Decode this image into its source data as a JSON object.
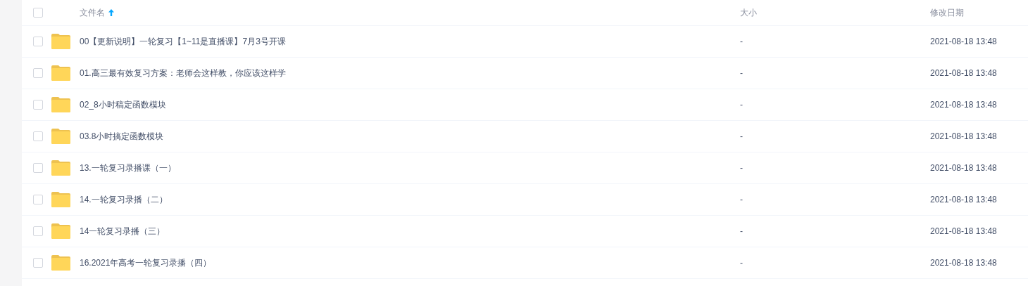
{
  "header": {
    "select_all": {
      "checked": false
    },
    "columns": [
      {
        "label": "文件名",
        "sorted": true
      },
      {
        "label": "大小",
        "sorted": false
      },
      {
        "label": "修改日期",
        "sorted": false
      }
    ]
  },
  "rows": [
    {
      "checked": false,
      "name": "00【更新说明】一轮复习【1~11是直播课】7月3号开课",
      "size": "-",
      "modified": "2021-08-18 13:48"
    },
    {
      "checked": false,
      "name": "01.高三最有效复习方案：老师会这样教，你应该这样学",
      "size": "-",
      "modified": "2021-08-18 13:48"
    },
    {
      "checked": false,
      "name": "02_8小时稿定函数模块",
      "size": "-",
      "modified": "2021-08-18 13:48"
    },
    {
      "checked": false,
      "name": "03.8小时搞定函数模块",
      "size": "-",
      "modified": "2021-08-18 13:48"
    },
    {
      "checked": false,
      "name": "13.一轮复习录播课（一）",
      "size": "-",
      "modified": "2021-08-18 13:48"
    },
    {
      "checked": false,
      "name": "14.一轮复习录播（二）",
      "size": "-",
      "modified": "2021-08-18 13:48"
    },
    {
      "checked": false,
      "name": "14一轮复习录播（三）",
      "size": "-",
      "modified": "2021-08-18 13:48"
    },
    {
      "checked": false,
      "name": "16.2021年高考一轮复习录播（四）",
      "size": "-",
      "modified": "2021-08-18 13:48"
    }
  ]
}
